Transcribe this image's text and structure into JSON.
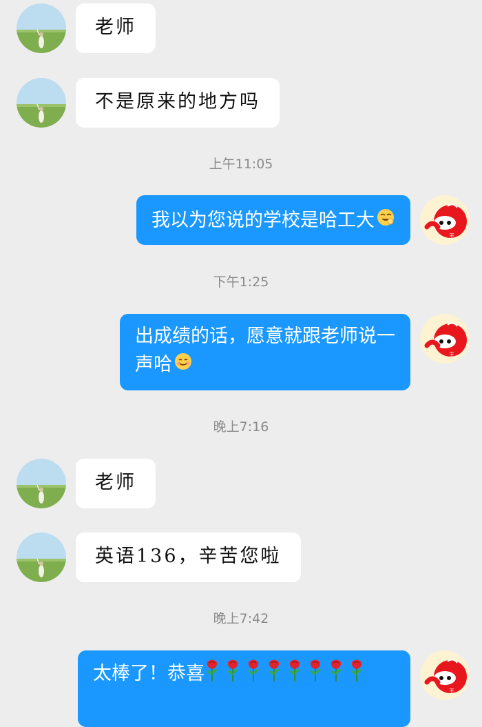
{
  "messages": [
    {
      "text": "老师"
    },
    {
      "text": "不是原来的地方吗"
    },
    {
      "time": "上午11:05"
    },
    {
      "text": "我以为您说的学校是哈工大",
      "emoji": "laugh-emoji"
    },
    {
      "time": "下午1:25"
    },
    {
      "line1": "出成绩的话，愿意就跟老师说一",
      "line2": "声哈",
      "emoji": "smile-emoji"
    },
    {
      "time": "晚上7:16"
    },
    {
      "text": "老师"
    },
    {
      "text": "英语136，辛苦您啦"
    },
    {
      "time": "晚上7:42"
    },
    {
      "text": "太棒了！恭喜",
      "emoji": "rose-emoji",
      "emoji_count": 8
    }
  ],
  "colors": {
    "background": "#ededed",
    "outgoing_bubble": "#1a98ff",
    "incoming_bubble": "#ffffff",
    "timestamp": "#8a8a8a"
  }
}
